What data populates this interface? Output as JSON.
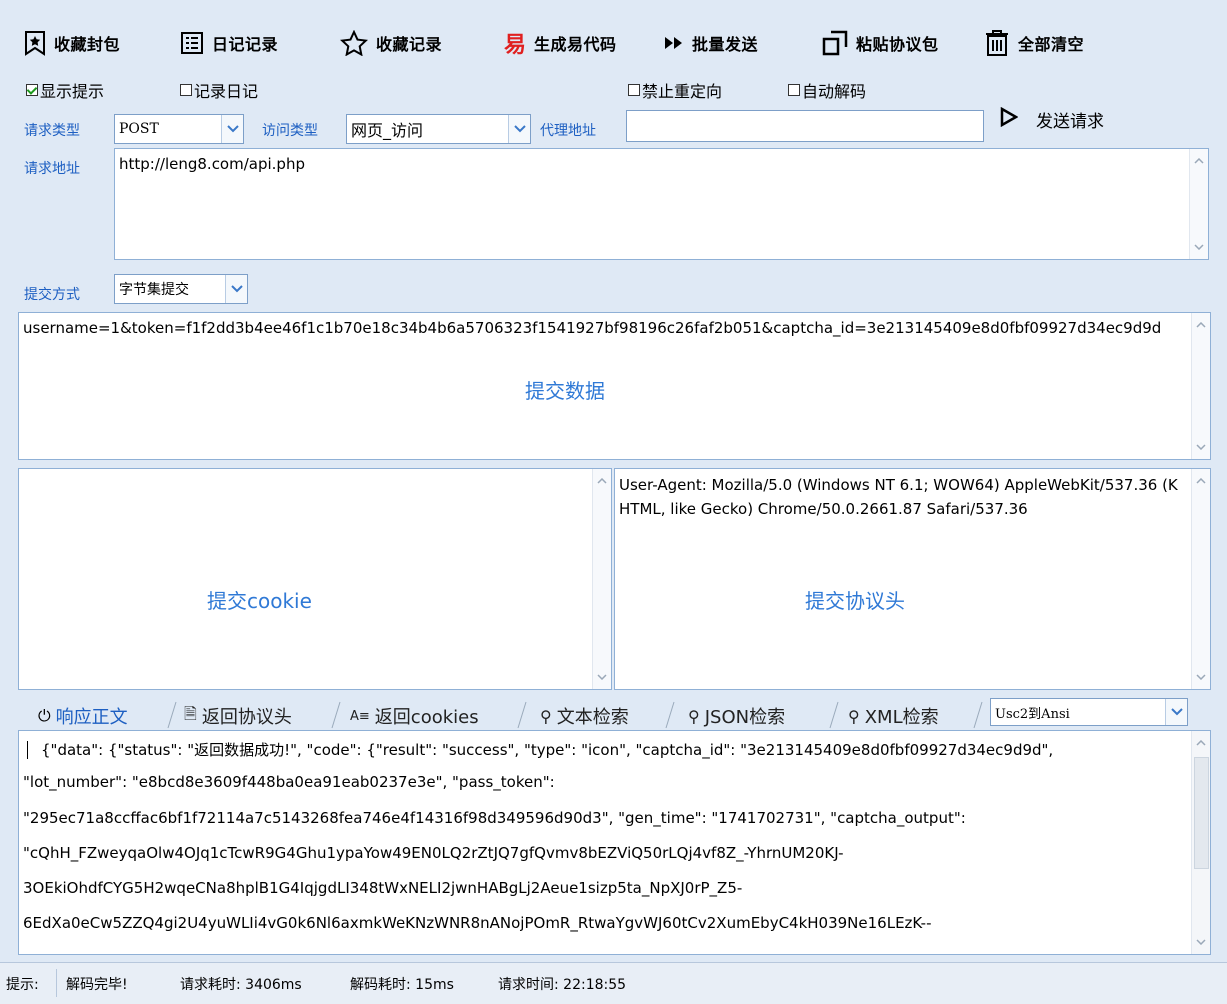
{
  "toolbar": {
    "items": [
      {
        "label": "收藏封包",
        "icon": "bookmark-star-icon"
      },
      {
        "label": "日记记录",
        "icon": "list-icon"
      },
      {
        "label": "收藏记录",
        "icon": "star-icon"
      },
      {
        "label": "生成易代码",
        "icon": "yi-icon",
        "icon_text": "易",
        "icon_color": "#e02020"
      },
      {
        "label": "批量发送",
        "icon": "fast-forward-icon"
      },
      {
        "label": "粘贴协议包",
        "icon": "paste-icon"
      },
      {
        "label": "全部清空",
        "icon": "trash-icon"
      }
    ]
  },
  "options": {
    "show_tips": {
      "label": "显示提示",
      "checked": true
    },
    "record_diary": {
      "label": "记录日记",
      "checked": false
    },
    "no_redirect": {
      "label": "禁止重定向",
      "checked": false
    },
    "auto_decode": {
      "label": "自动解码",
      "checked": false
    }
  },
  "request": {
    "method_label": "请求类型",
    "method_value": "POST",
    "access_label": "访问类型",
    "access_value": "网页_访问",
    "proxy_label": "代理地址",
    "proxy_value": "",
    "send_label": "发送请求",
    "url_label": "请求地址",
    "url_value": "http://leng8.com/api.php",
    "submit_mode_label": "提交方式",
    "submit_mode_value": "字节集提交",
    "post_data": "username=1&token=f1f2dd3b4ee46f1c1b70e18c34b4b6a5706323f1541927bf98196c26faf2b051&captcha_id=3e213145409e8d0fbf09927d34ec9d9d",
    "post_data_watermark": "提交数据",
    "cookie_value": "",
    "cookie_watermark": "提交cookie",
    "headers_value": "User-Agent: Mozilla/5.0 (Windows NT 6.1; WOW64) AppleWebKit/537.36 (KHTML, like Gecko) Chrome/50.0.2661.87 Safari/537.36",
    "headers_watermark": "提交协议头"
  },
  "tabs": [
    {
      "label": "响应正文",
      "icon": "response-icon",
      "icon_glyph": "⏻",
      "active": true
    },
    {
      "label": "返回协议头",
      "icon": "document-icon",
      "icon_glyph": "🗎",
      "active": false
    },
    {
      "label": "返回cookies",
      "icon": "text-format-icon",
      "icon_glyph": "A≡",
      "active": false
    },
    {
      "label": "文本检索",
      "icon": "search-icon",
      "icon_glyph": "⚲",
      "active": false
    },
    {
      "label": "JSON检索",
      "icon": "search-icon",
      "icon_glyph": "⚲",
      "active": false
    },
    {
      "label": "XML检索",
      "icon": "search-icon",
      "icon_glyph": "⚲",
      "active": false
    }
  ],
  "encoding": {
    "value": "Usc2到Ansi"
  },
  "response": {
    "lines": [
      "{\"data\": {\"status\": \"返回数据成功!\", \"code\": {\"result\": \"success\", \"type\": \"icon\", \"captcha_id\": \"3e213145409e8d0fbf09927d34ec9d9d\",",
      "\"lot_number\": \"e8bcd8e3609f448ba0ea91eab0237e3e\", \"pass_token\":",
      "\"295ec71a8ccffac6bf1f72114a7c5143268fea746e4f14316f98d349596d90d3\", \"gen_time\": \"1741702731\", \"captcha_output\":",
      "\"cQhH_FZweyqaOlw4OJq1cTcwR9G4Ghu1ypaYow49EN0LQ2rZtJQ7gfQvmv8bEZViQ50rLQj4vf8Z_-YhrnUM20KJ-",
      "3OEkiOhdfCYG5H2wqeCNa8hplB1G4IqjgdLI348tWxNELI2jwnHABgLj2Aeue1sizp5ta_NpXJ0rP_Z5-",
      "6EdXa0eCw5ZZQ4gi2U4yuWLIi4vG0k6Nl6axmkWeKNzWNR8nANojPOmR_RtwaYgvWJ60tCv2XumEbyC4kH039Ne16LEzK--"
    ]
  },
  "status": {
    "prefix": "提示:",
    "message": "解码完毕!",
    "request_time": "请求耗时: 3406ms",
    "decode_time": "解码耗时: 15ms",
    "clock": "请求时间: 22:18:55"
  },
  "colors": {
    "accent": "#1d5fc2",
    "watermark": "#2f79d6",
    "background": "#dfe9f5"
  }
}
